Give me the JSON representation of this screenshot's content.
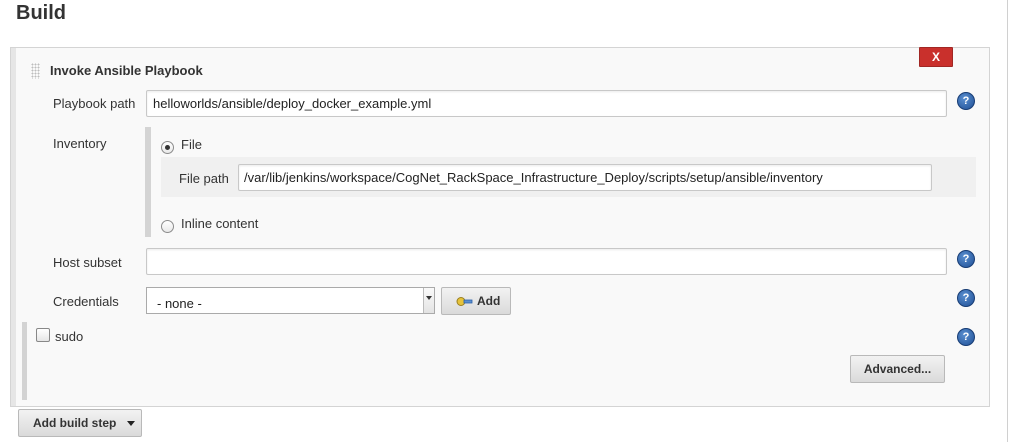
{
  "section": {
    "title": "Build"
  },
  "step": {
    "title": "Invoke Ansible Playbook",
    "delete_label": "X"
  },
  "playbook": {
    "label": "Playbook path",
    "value": "helloworlds/ansible/deploy_docker_example.yml"
  },
  "inventory": {
    "label": "Inventory",
    "file_option": "File",
    "file_selected": true,
    "file_path_label": "File path",
    "file_path_value": "/var/lib/jenkins/workspace/CogNet_RackSpace_Infrastructure_Deploy/scripts/setup/ansible/inventory",
    "inline_option": "Inline content"
  },
  "host_subset": {
    "label": "Host subset",
    "value": ""
  },
  "credentials": {
    "label": "Credentials",
    "selected": "- none -",
    "add_label": "Add"
  },
  "sudo": {
    "label": "sudo",
    "checked": false
  },
  "advanced_label": "Advanced...",
  "add_build_step_label": "Add build step",
  "help_glyph": "?",
  "colors": {
    "delete_button": "#c9302c",
    "help_icon": "#2a5fa8"
  }
}
